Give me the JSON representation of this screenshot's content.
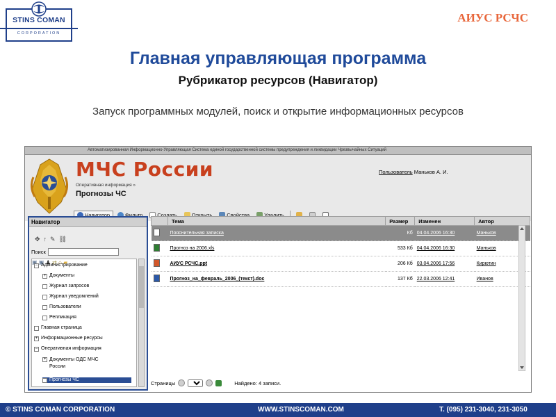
{
  "slide": {
    "logo_name": "STINS COMAN",
    "logo_corp": "CORPORATION",
    "brand": "АИУС РСЧС",
    "title": "Главная управляющая программа",
    "subtitle": "Рубрикатор ресурсов (Навигатор)",
    "description": "Запуск программных модулей, поиск и открытие информационных ресурсов",
    "footer_left": "© STINS COMAN CORPORATION",
    "footer_center": "WWW.STINSCOMAN.COM",
    "footer_right": "T. (095) 231-3040, 231-3050",
    "accent": "#1f3f8a",
    "brand_color": "#e8663a"
  },
  "app": {
    "system_title": "Автоматизированная Информационно-Управляющая Система единой государственной системы предупреждения и ликвидации Чрезвычайных Ситуаций",
    "logo_text": "МЧС России",
    "breadcrumb": "Оперативная информация »",
    "page_title": "Прогнозы ЧС",
    "user_label": "Пользователь",
    "user_name": "Маньков А. И.",
    "toolbar": {
      "navigator": "Навигатор",
      "filter": "Фильтр",
      "create": "Создать",
      "open": "Открыть",
      "properties": "Свойства",
      "delete": "Удалить"
    },
    "navigator": {
      "title": "Навигатор",
      "search_label": "Поиск",
      "search_value": "",
      "tree": [
        {
          "label": "Администрирование",
          "expander": "−"
        },
        {
          "label": "Документы",
          "expander": "+"
        },
        {
          "label": "Журнал запросов",
          "expander": ""
        },
        {
          "label": "Журнал уведомлений",
          "expander": ""
        },
        {
          "label": "Пользователи",
          "expander": ""
        },
        {
          "label": "Репликация",
          "expander": ""
        },
        {
          "label": "Главная страница",
          "expander": ""
        },
        {
          "label": "Информационные ресурсы",
          "expander": "+"
        },
        {
          "label": "Оперативная информация",
          "expander": "−"
        },
        {
          "label": "Документы ОДС МЧС России",
          "expander": "+"
        },
        {
          "label": "Прогнозы ЧС",
          "expander": ""
        }
      ]
    },
    "table": {
      "columns": [
        "Тема",
        "Размер",
        "Изменен",
        "Автор"
      ],
      "rows": [
        {
          "title": "Пояснительная записка",
          "size": "Кб",
          "modified": "04.04.2006 16:30",
          "author": "Маньков"
        },
        {
          "title": "Прогноз на 2006.xls",
          "size": "533 Кб",
          "modified": "04.04.2006 16:30",
          "author": "Маньков"
        },
        {
          "title": "АИУС РСЧС.ppt",
          "size": "206 Кб",
          "modified": "03.04.2006 17:56",
          "author": "Кирютин"
        },
        {
          "title": "Прогноз_на_февраль_2006_(текст).doc",
          "size": "137 Кб",
          "modified": "22.03.2006 12:41",
          "author": "Иванов"
        }
      ]
    },
    "footer": {
      "pages_label": "Страницы",
      "page_value": "1",
      "found": "Найдено: 4 записи."
    }
  }
}
